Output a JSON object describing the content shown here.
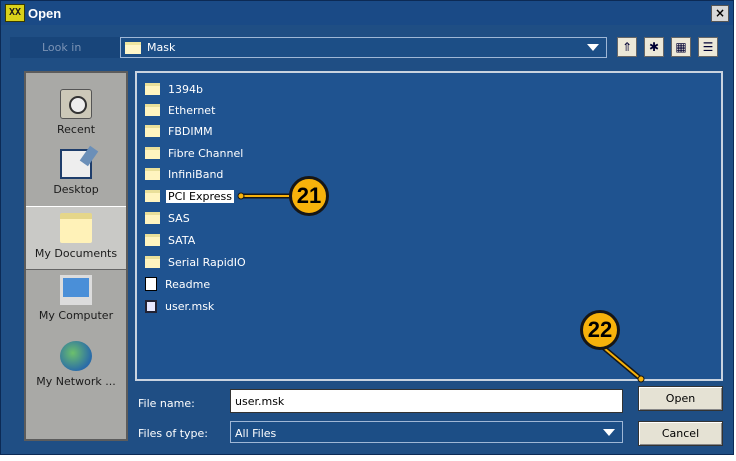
{
  "window": {
    "title": "Open",
    "app_icon": "XX",
    "close_label": "×"
  },
  "toolbar": {
    "look_in_label": "Look in",
    "look_in_value": "Mask",
    "buttons": [
      {
        "name": "up-folder-icon",
        "glyph": "⇑"
      },
      {
        "name": "new-folder-icon",
        "glyph": "✱"
      },
      {
        "name": "list-view-icon",
        "glyph": "▦"
      },
      {
        "name": "details-view-icon",
        "glyph": "☰"
      }
    ]
  },
  "places": [
    {
      "label": "Recent",
      "icon": "recent-icon"
    },
    {
      "label": "Desktop",
      "icon": "desktop-icon"
    },
    {
      "label": "My Documents",
      "icon": "my-documents-icon"
    },
    {
      "label": "My Computer",
      "icon": "my-computer-icon"
    },
    {
      "label": "My Network ...",
      "icon": "my-network-icon"
    }
  ],
  "files": [
    {
      "name": "1394b",
      "type": "folder"
    },
    {
      "name": "Ethernet",
      "type": "folder"
    },
    {
      "name": "FBDIMM",
      "type": "folder"
    },
    {
      "name": "Fibre Channel",
      "type": "folder"
    },
    {
      "name": "InfiniBand",
      "type": "folder"
    },
    {
      "name": "PCI Express",
      "type": "folder",
      "selected": true
    },
    {
      "name": "SAS",
      "type": "folder"
    },
    {
      "name": "SATA",
      "type": "folder"
    },
    {
      "name": "Serial RapidIO",
      "type": "folder"
    },
    {
      "name": "Readme",
      "type": "document"
    },
    {
      "name": "user.msk",
      "type": "msk"
    }
  ],
  "file_name": {
    "label": "File name:",
    "value": "user.msk"
  },
  "file_type": {
    "label": "Files of type:",
    "value": "All Files"
  },
  "buttons": {
    "open": "Open",
    "cancel": "Cancel"
  },
  "callouts": {
    "a": "21",
    "b": "22"
  },
  "colors": {
    "callout": "#f7b20b",
    "window_bg": "#1f4e84"
  }
}
